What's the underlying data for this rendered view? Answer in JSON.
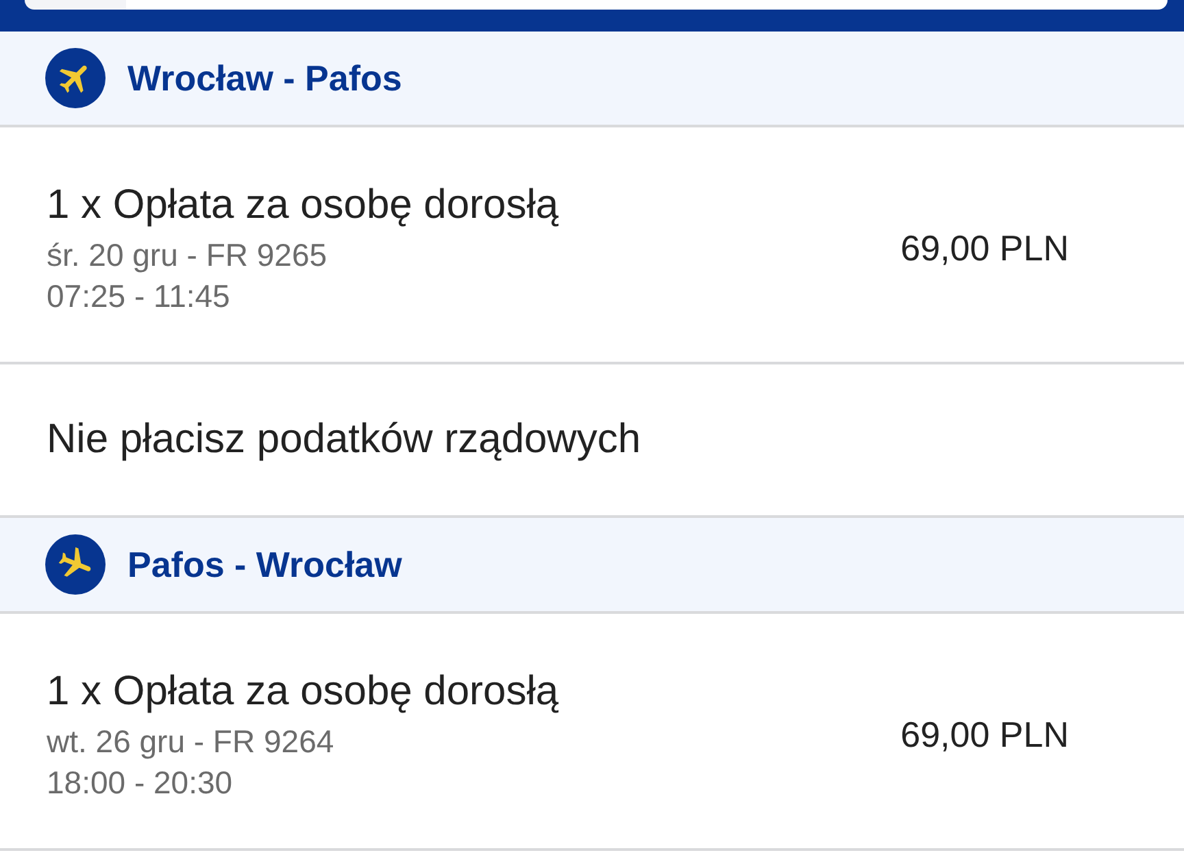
{
  "segments": [
    {
      "kind": "outbound",
      "route": "Wrocław - Pafos",
      "fares": [
        {
          "title": "1 x Opłata za osobę dorosłą",
          "date_flight": "śr. 20 gru - FR 9265",
          "times": "07:25 - 11:45",
          "price": "69,00 PLN"
        }
      ],
      "note": "Nie płacisz podatków rządowych"
    },
    {
      "kind": "return",
      "route": "Pafos - Wrocław",
      "fares": [
        {
          "title": "1 x Opłata za osobę dorosłą",
          "date_flight": "wt. 26 gru - FR 9264",
          "times": "18:00 - 20:30",
          "price": "69,00 PLN"
        }
      ]
    }
  ]
}
